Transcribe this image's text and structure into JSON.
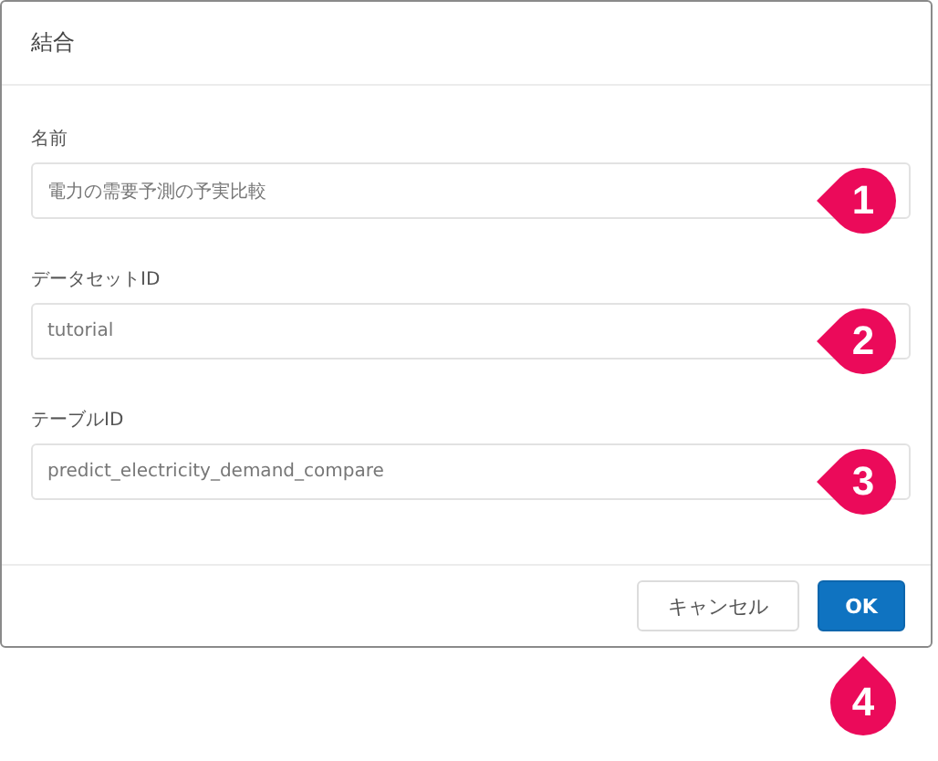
{
  "dialog": {
    "title": "結合",
    "fields": [
      {
        "label": "名前",
        "value": "電力の需要予測の予実比較"
      },
      {
        "label": "データセットID",
        "value": "tutorial"
      },
      {
        "label": "テーブルID",
        "value": "predict_electricity_demand_compare"
      }
    ],
    "buttons": [
      {
        "label": "キャンセル",
        "kind": "secondary"
      },
      {
        "label": "OK",
        "kind": "primary"
      }
    ]
  },
  "callouts": [
    {
      "number": "1",
      "kind": "left"
    },
    {
      "number": "2",
      "kind": "left"
    },
    {
      "number": "3",
      "kind": "left"
    },
    {
      "number": "4",
      "kind": "up"
    }
  ]
}
